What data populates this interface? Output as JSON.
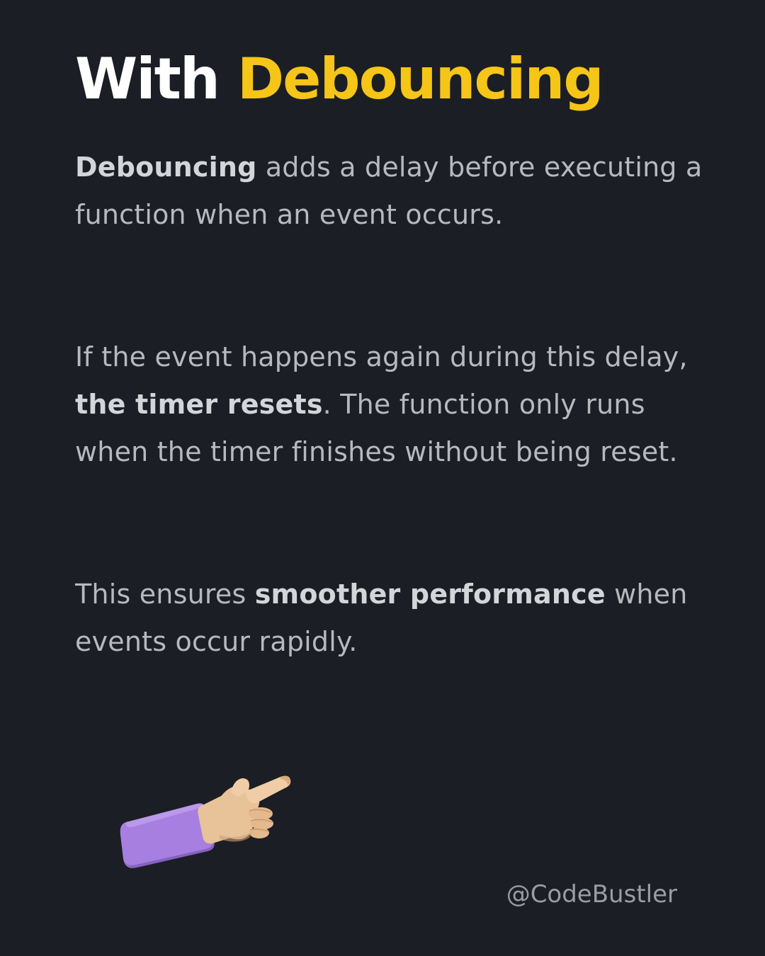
{
  "title": {
    "plain": "With",
    "accent": "Debouncing"
  },
  "paragraph1": {
    "bold": "Debouncing",
    "rest": " adds a delay before executing a function when an event occurs."
  },
  "paragraph2": {
    "before": "If the event happens again during this delay, ",
    "bold": "the timer resets",
    "after": ". The function only runs when the timer finishes without being reset."
  },
  "paragraph3": {
    "before": "This ensures ",
    "bold": "smoother performance",
    "after": " when events occur rapidly."
  },
  "illustration": {
    "icon": "pointing-hand-icon",
    "sleeve_color": "#a77fe0",
    "skin_color": "#e8c299"
  },
  "handle": "@CodeBustler",
  "colors": {
    "background": "#1b1e24",
    "accent": "#f5c518",
    "title": "#ffffff",
    "body_text": "#b7b9bd"
  }
}
